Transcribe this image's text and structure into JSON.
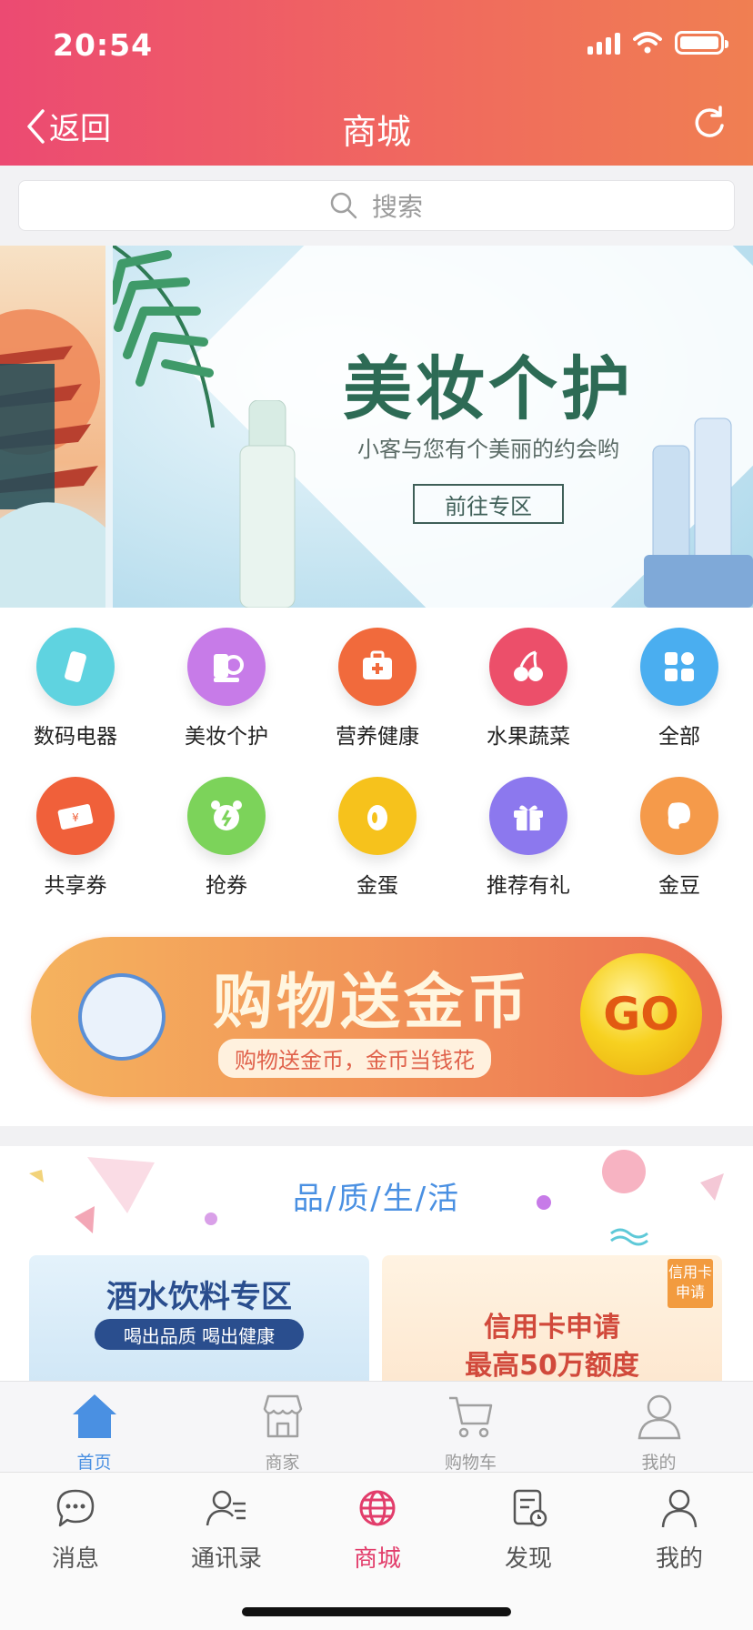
{
  "status_bar": {
    "time": "20:54"
  },
  "nav": {
    "back_label": "返回",
    "title": "商城"
  },
  "search": {
    "placeholder": "搜索"
  },
  "banner": {
    "title": "美妆个护",
    "subtitle": "小客与您有个美丽的约会哟",
    "cta": "前往专区"
  },
  "categories": [
    {
      "label": "数码电器",
      "icon": "phone-icon",
      "color": "#5fd3e0"
    },
    {
      "label": "美妆个护",
      "icon": "cosmetics-icon",
      "color": "#c77be8"
    },
    {
      "label": "营养健康",
      "icon": "medical-kit-icon",
      "color": "#f16a3c"
    },
    {
      "label": "水果蔬菜",
      "icon": "cherry-icon",
      "color": "#ec4f6a"
    },
    {
      "label": "全部",
      "icon": "grid-icon",
      "color": "#4aaef0"
    },
    {
      "label": "共享券",
      "icon": "coupon-icon",
      "color": "#f0603a"
    },
    {
      "label": "抢券",
      "icon": "alarm-clock-icon",
      "color": "#7cd35a"
    },
    {
      "label": "金蛋",
      "icon": "golden-egg-icon",
      "color": "#f6c21c"
    },
    {
      "label": "推荐有礼",
      "icon": "gift-icon",
      "color": "#8c78ee"
    },
    {
      "label": "金豆",
      "icon": "bean-icon",
      "color": "#f59a4a"
    }
  ],
  "promo": {
    "title": "购物送金币",
    "subtitle": "购物送金币，金币当钱花",
    "go_label": "GO"
  },
  "quality": {
    "title": "品/质/生/活",
    "cards": [
      {
        "title": "酒水饮料专区",
        "tagline": "喝出品质  喝出健康"
      },
      {
        "badge": "信用卡申请",
        "title": "信用卡申请",
        "subtitle": "最高50万额度"
      }
    ]
  },
  "inner_tabs": [
    {
      "label": "首页",
      "active": true
    },
    {
      "label": "商家",
      "active": false
    },
    {
      "label": "购物车",
      "active": false
    },
    {
      "label": "我的",
      "active": false
    }
  ],
  "outer_tabs": [
    {
      "label": "消息",
      "active": false
    },
    {
      "label": "通讯录",
      "active": false
    },
    {
      "label": "商城",
      "active": true
    },
    {
      "label": "发现",
      "active": false
    },
    {
      "label": "我的",
      "active": false
    }
  ],
  "colors": {
    "header_start": "#ec4a72",
    "header_end": "#f07f52",
    "accent_blue": "#4a90e2",
    "accent_red": "#e23d6b"
  }
}
